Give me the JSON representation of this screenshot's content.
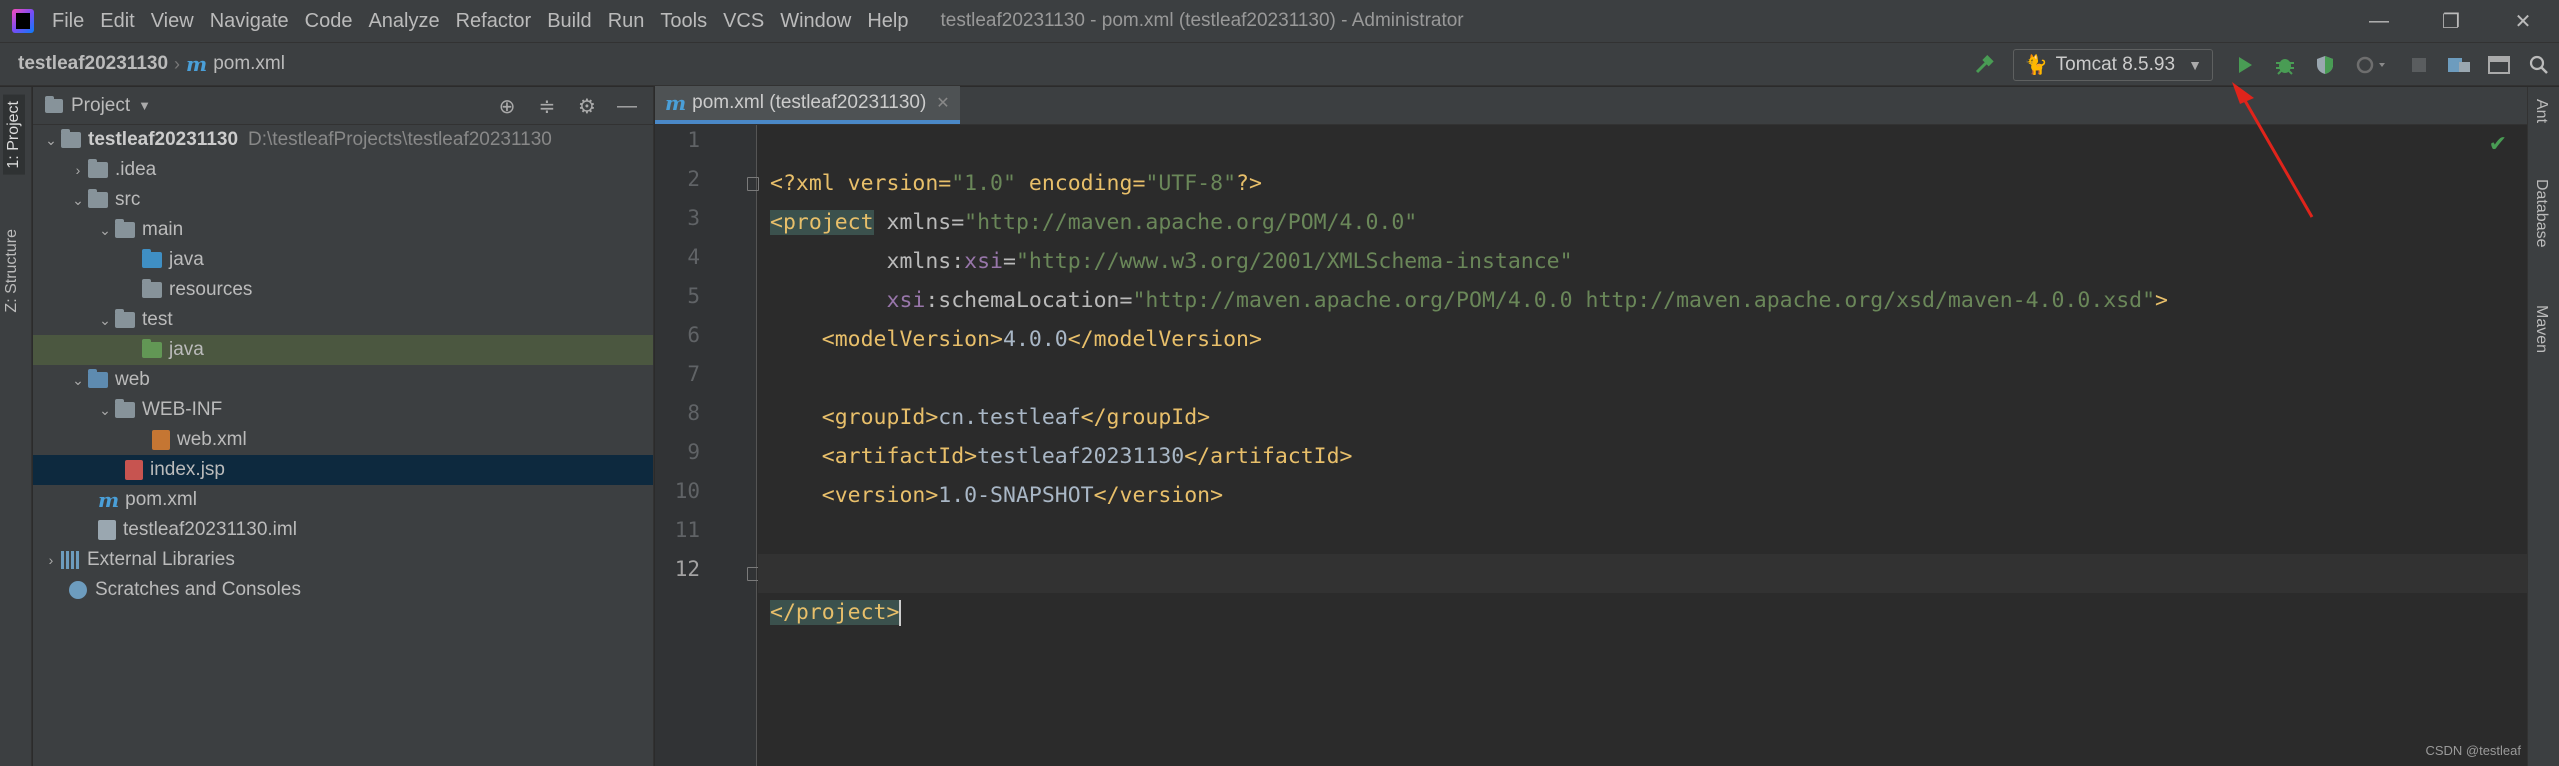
{
  "titlebar": {
    "menu": [
      "File",
      "Edit",
      "View",
      "Navigate",
      "Code",
      "Analyze",
      "Refactor",
      "Build",
      "Run",
      "Tools",
      "VCS",
      "Window",
      "Help"
    ],
    "window_title": "testleaf20231130 - pom.xml (testleaf20231130) - Administrator",
    "controls": {
      "minimize": "—",
      "maximize": "❐",
      "close": "✕"
    }
  },
  "navbar": {
    "project": "testleaf20231130",
    "file": "pom.xml",
    "run_config": "Tomcat 8.5.93"
  },
  "left_strip": {
    "project_tab": "1: Project",
    "structure_tab": "Z: Structure"
  },
  "project_panel": {
    "title": "Project",
    "tree": [
      {
        "label": "testleaf20231130",
        "hint": "D:\\testleafProjects\\testleaf20231130"
      },
      {
        "label": ".idea"
      },
      {
        "label": "src"
      },
      {
        "label": "main"
      },
      {
        "label": "java"
      },
      {
        "label": "resources"
      },
      {
        "label": "test"
      },
      {
        "label": "java"
      },
      {
        "label": "web"
      },
      {
        "label": "WEB-INF"
      },
      {
        "label": "web.xml"
      },
      {
        "label": "index.jsp"
      },
      {
        "label": "pom.xml"
      },
      {
        "label": "testleaf20231130.iml"
      },
      {
        "label": "External Libraries"
      },
      {
        "label": "Scratches and Consoles"
      }
    ]
  },
  "editor": {
    "tab_label": "pom.xml (testleaf20231130)",
    "line_numbers": [
      "1",
      "2",
      "3",
      "4",
      "5",
      "6",
      "7",
      "8",
      "9",
      "10",
      "11",
      "12"
    ],
    "code": {
      "l1": {
        "a": "<?xml version=",
        "b": "\"1.0\"",
        "c": " encoding=",
        "d": "\"UTF-8\"",
        "e": "?>"
      },
      "l2": {
        "a": "<project",
        "b": " xmlns=",
        "c": "\"http://maven.apache.org/POM/4.0.0\""
      },
      "l3": {
        "a": "         xmlns:",
        "b": "xsi",
        "c": "=",
        "d": "\"http://www.w3.org/2001/XMLSchema-instance\""
      },
      "l4": {
        "a": "         ",
        "b": "xsi",
        "c": ":schemaLocation=",
        "d": "\"http://maven.apache.org/POM/4.0.0 http://maven.apache.org/xsd/maven-4.0.0.xsd\"",
        "e": ">"
      },
      "l5": {
        "a": "    <modelVersion>",
        "b": "4.0.0",
        "c": "</modelVersion>"
      },
      "l7": {
        "a": "    <groupId>",
        "b": "cn.testleaf",
        "c": "</groupId>"
      },
      "l8": {
        "a": "    <artifactId>",
        "b": "testleaf20231130",
        "c": "</artifactId>"
      },
      "l9": {
        "a": "    <version>",
        "b": "1.0-SNAPSHOT",
        "c": "</version>"
      },
      "l12": {
        "a": "</project>"
      }
    }
  },
  "right_strip": {
    "tabs": [
      "Ant",
      "Database",
      "Maven"
    ]
  },
  "watermark": "CSDN @testleaf",
  "colors": {
    "background": "#2b2b2b",
    "panel": "#3c3f41",
    "tag": "#e8bf6a",
    "string": "#6a8759",
    "annotation_arrow": "#e0241b",
    "run": "#499c54"
  }
}
